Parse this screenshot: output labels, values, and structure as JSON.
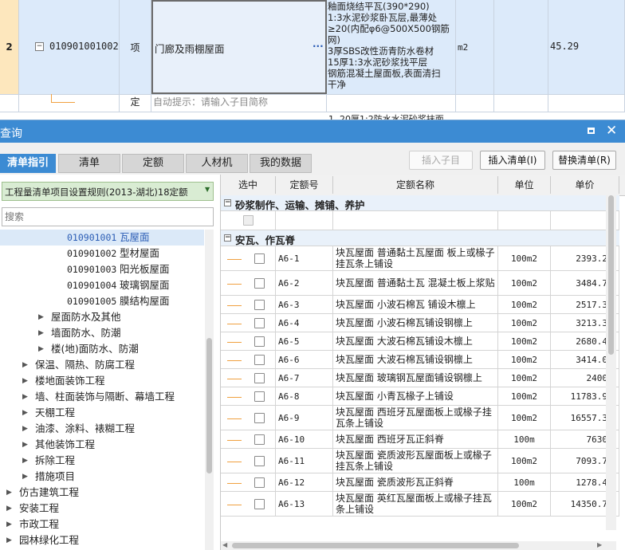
{
  "background": {
    "row": {
      "index": "2",
      "code": "010901001002",
      "type": "项",
      "name": "门廊及雨棚屋面",
      "name_more": "···",
      "features": [
        "釉面烧结平瓦(390*290)",
        "1:3水泥砂浆卧瓦层,最薄处",
        "≥20(内配φ6@500X500钢筋",
        "网)",
        "3厚SBS改性沥青防水卷材",
        "15厚1:3水泥砂浆找平层",
        "钢筋混凝土屋面板,表面清扫",
        "干净"
      ],
      "unit": "m2",
      "quantity": "45.29"
    },
    "sub_row": {
      "type": "定",
      "hint": "自动提示：请输入子目简称"
    },
    "partial_text": "1. 20厚1:2防水水泥砂浆抹面"
  },
  "dialog": {
    "title": "查询",
    "window_controls": {
      "maximize": "maximize-icon",
      "close": "close-icon"
    },
    "tabs": [
      "清单指引",
      "清单",
      "定额",
      "人材机",
      "我的数据"
    ],
    "active_tab": "清单指引",
    "buttons": {
      "insert_sub": "插入子目",
      "insert_list": "插入清单(I)",
      "replace_list": "替换清单(R)"
    },
    "rule_select": "工程量清单项目设置规则(2013-湖北)18定额",
    "search_placeholder": "搜索",
    "tree": [
      {
        "code": "010901001",
        "label": "瓦屋面",
        "level": 3,
        "selected": true
      },
      {
        "code": "010901002",
        "label": "型材屋面",
        "level": 3
      },
      {
        "code": "010901003",
        "label": "阳光板屋面",
        "level": 3
      },
      {
        "code": "010901004",
        "label": "玻璃钢屋面",
        "level": 3
      },
      {
        "code": "010901005",
        "label": "膜结构屋面",
        "level": 3
      },
      {
        "label": "屋面防水及其他",
        "level": 2
      },
      {
        "label": "墙面防水、防潮",
        "level": 2
      },
      {
        "label": "楼(地)面防水、防潮",
        "level": 2
      },
      {
        "label": "保温、隔热、防腐工程",
        "level": 1
      },
      {
        "label": "楼地面装饰工程",
        "level": 1
      },
      {
        "label": "墙、柱面装饰与隔断、幕墙工程",
        "level": 1
      },
      {
        "label": "天棚工程",
        "level": 1
      },
      {
        "label": "油漆、涂料、裱糊工程",
        "level": 1
      },
      {
        "label": "其他装饰工程",
        "level": 1
      },
      {
        "label": "拆除工程",
        "level": 1
      },
      {
        "label": "措施项目",
        "level": 1
      },
      {
        "label": "仿古建筑工程",
        "level": 0
      },
      {
        "label": "安装工程",
        "level": 0
      },
      {
        "label": "市政工程",
        "level": 0
      },
      {
        "label": "园林绿化工程",
        "level": 0
      }
    ],
    "grid": {
      "headers": [
        "选中",
        "定额号",
        "定额名称",
        "单位",
        "单价"
      ],
      "groups": [
        {
          "title": "砂浆制作、运输、摊铺、养护",
          "rows": []
        },
        {
          "title": "安瓦、作瓦脊",
          "rows": [
            {
              "code": "A6-1",
              "name": "块瓦屋面 普通黏土瓦屋面 板上或椽子挂瓦条上铺设",
              "unit": "100m2",
              "price": "2393.2"
            },
            {
              "code": "A6-2",
              "name": "块瓦屋面 普通黏土瓦 混凝土板上浆贴",
              "unit": "100m2",
              "price": "3484.7"
            },
            {
              "code": "A6-3",
              "name": "块瓦屋面 小波石棉瓦 铺设木檩上",
              "unit": "100m2",
              "price": "2517.3"
            },
            {
              "code": "A6-4",
              "name": "块瓦屋面 小波石棉瓦铺设钢檩上",
              "unit": "100m2",
              "price": "3213.3"
            },
            {
              "code": "A6-5",
              "name": "块瓦屋面 大波石棉瓦铺设木檩上",
              "unit": "100m2",
              "price": "2680.4"
            },
            {
              "code": "A6-6",
              "name": "块瓦屋面 大波石棉瓦铺设钢檩上",
              "unit": "100m2",
              "price": "3414.0"
            },
            {
              "code": "A6-7",
              "name": "块瓦屋面 玻璃钢瓦屋面铺设钢檩上",
              "unit": "100m2",
              "price": "2400"
            },
            {
              "code": "A6-8",
              "name": "块瓦屋面 小青瓦椽子上铺设",
              "unit": "100m2",
              "price": "11783.9"
            },
            {
              "code": "A6-9",
              "name": "块瓦屋面 西班牙瓦屋面板上或椽子挂瓦条上铺设",
              "unit": "100m2",
              "price": "16557.3"
            },
            {
              "code": "A6-10",
              "name": "块瓦屋面 西班牙瓦正斜脊",
              "unit": "100m",
              "price": "7630"
            },
            {
              "code": "A6-11",
              "name": "块瓦屋面 瓷质波形瓦屋面板上或椽子挂瓦条上铺设",
              "unit": "100m2",
              "price": "7093.7"
            },
            {
              "code": "A6-12",
              "name": "块瓦屋面 瓷质波形瓦正斜脊",
              "unit": "100m",
              "price": "1278.4"
            },
            {
              "code": "A6-13",
              "name": "块瓦屋面 英红瓦屋面板上或椽子挂瓦条上铺设",
              "unit": "100m2",
              "price": "14350.7"
            }
          ]
        }
      ]
    }
  },
  "colors": {
    "accent": "#3c8bd3",
    "selected_row": "#dbe9f8",
    "group_row": "#e9f1fa",
    "tree_green": "#d9ecd3"
  }
}
